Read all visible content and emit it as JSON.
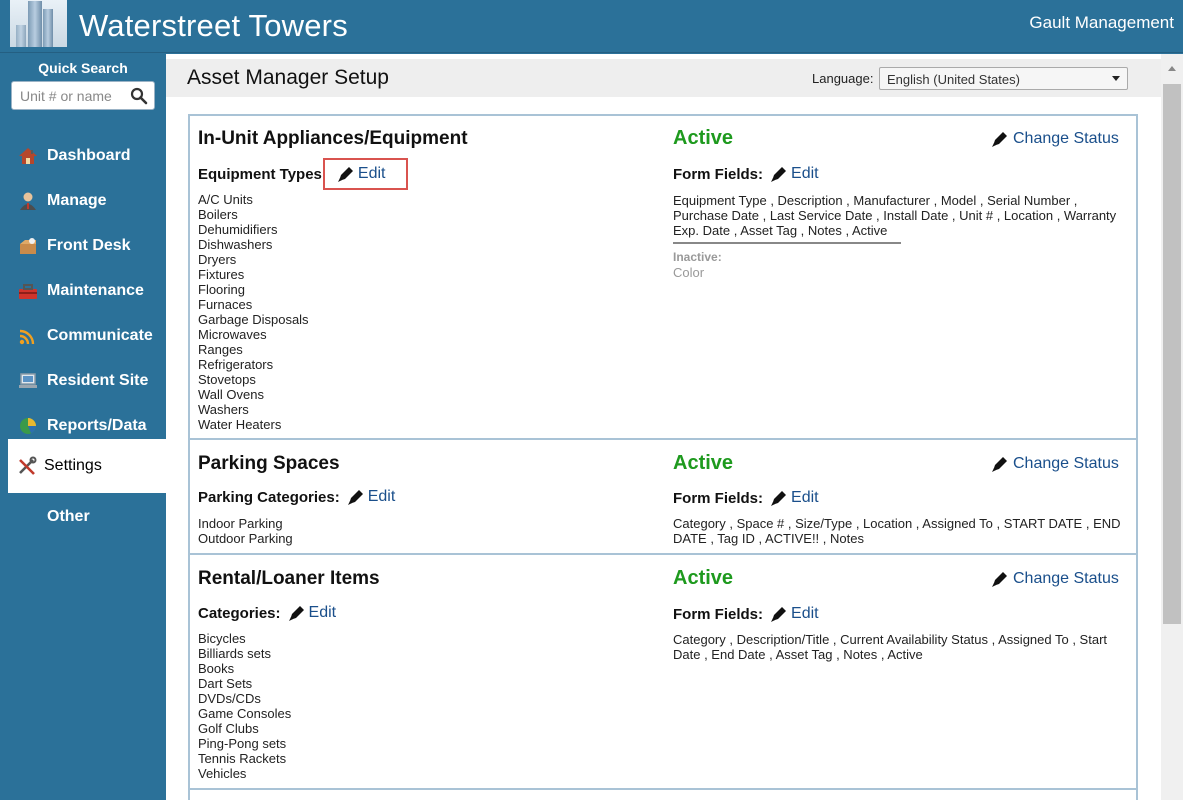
{
  "header": {
    "site_title": "Waterstreet Towers",
    "company": "Gault Management"
  },
  "sidebar": {
    "quick_search_label": "Quick Search",
    "quick_search_placeholder": "Unit # or name",
    "items": [
      {
        "label": "Dashboard",
        "icon": "house-icon"
      },
      {
        "label": "Manage",
        "icon": "person-icon"
      },
      {
        "label": "Front Desk",
        "icon": "package-icon"
      },
      {
        "label": "Maintenance",
        "icon": "toolbox-icon"
      },
      {
        "label": "Communicate",
        "icon": "wifi-icon"
      },
      {
        "label": "Resident Site",
        "icon": "laptop-icon"
      },
      {
        "label": "Reports/Data",
        "icon": "pie-chart-icon"
      },
      {
        "label": "Settings",
        "icon": "tools-icon",
        "active": true
      },
      {
        "label": "Other"
      }
    ]
  },
  "main": {
    "page_title": "Asset Manager Setup",
    "language_label": "Language:",
    "language_value": "English (United States)",
    "change_status_label": "Change Status",
    "edit_label": "Edit",
    "form_fields_label": "Form Fields:",
    "sections": [
      {
        "title": "In-Unit Appliances/Equipment",
        "status": "Active",
        "subheading": "Equipment Types",
        "items": [
          "A/C Units",
          "Boilers",
          "Dehumidifiers",
          "Dishwashers",
          "Dryers",
          "Fixtures",
          "Flooring",
          "Furnaces",
          "Garbage Disposals",
          "Microwaves",
          "Ranges",
          "Refrigerators",
          "Stovetops",
          "Wall Ovens",
          "Washers",
          "Water Heaters"
        ],
        "form_fields": "Equipment Type , Description , Manufacturer , Model , Serial Number , Purchase Date , Last Service Date , Install Date , Unit # , Location , Warranty Exp. Date , Asset Tag , Notes , Active",
        "inactive_label": "Inactive:",
        "inactive_fields": "Color"
      },
      {
        "title": "Parking Spaces",
        "status": "Active",
        "subheading": "Parking Categories:",
        "items": [
          "Indoor Parking",
          "Outdoor Parking"
        ],
        "form_fields": "Category , Space # , Size/Type , Location , Assigned To , START DATE , END DATE , Tag ID , ACTIVE!! , Notes"
      },
      {
        "title": "Rental/Loaner Items",
        "status": "Active",
        "subheading": "Categories:",
        "items": [
          "Bicycles",
          "Billiards sets",
          "Books",
          "Dart Sets",
          "DVDs/CDs",
          "Game Consoles",
          "Golf Clubs",
          "Ping-Pong sets",
          "Tennis Rackets",
          "Vehicles"
        ],
        "form_fields": "Category , Description/Title , Current Availability Status , Assigned To , Start Date , End Date , Asset Tag , Notes , Active"
      }
    ]
  },
  "colors": {
    "brand": "#2b7199",
    "status_active": "#1e9a1e",
    "link": "#1a4f8b",
    "highlight": "#d9534f"
  }
}
